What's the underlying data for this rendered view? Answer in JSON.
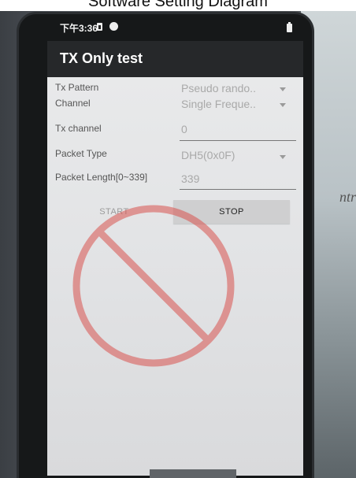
{
  "caption": "Software Setting Diagram",
  "status_bar": {
    "time": "下午3:36",
    "icons": [
      "sim-card-icon",
      "app-notification-icon",
      "battery-icon"
    ]
  },
  "app_bar": {
    "title": "TX Only test"
  },
  "form": {
    "tx_pattern": {
      "label": "Tx Pattern",
      "value": "Pseudo rando.."
    },
    "channel": {
      "label": "Channel",
      "value": "Single Freque.."
    },
    "tx_channel": {
      "label": "Tx channel",
      "value": "0"
    },
    "packet_type": {
      "label": "Packet Type",
      "value": "DH5(0x0F)"
    },
    "packet_length": {
      "label": "Packet Length[0~339]",
      "value": "339"
    }
  },
  "buttons": {
    "start": "START",
    "stop": "STOP"
  },
  "background_text": {
    "wall_sign": "ntr"
  },
  "colors": {
    "app_bar": "#26282a",
    "screen": "#e6e7e8",
    "stamp": "#d9534f"
  }
}
